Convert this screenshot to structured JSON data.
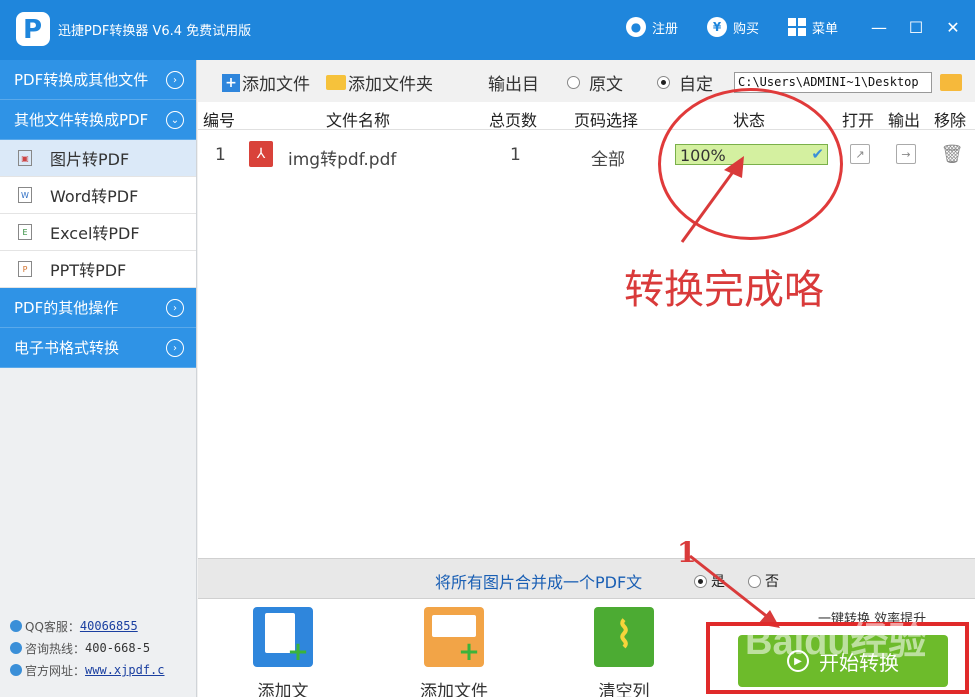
{
  "titlebar": {
    "app_title": "迅捷PDF转换器 V6.4 免费试用版",
    "register_label": "注册",
    "buy_label": "购买",
    "menu_label": "菜单",
    "brand_color": "#1f86dc"
  },
  "sidebar": {
    "categories": [
      {
        "label": "PDF转换成其他文件"
      },
      {
        "label": "其他文件转换成PDF"
      },
      {
        "label": "PDF的其他操作"
      },
      {
        "label": "电子书格式转换"
      }
    ],
    "items": [
      {
        "label": "图片转PDF",
        "icon": "image-file-icon"
      },
      {
        "label": "Word转PDF",
        "icon": "word-file-icon"
      },
      {
        "label": "Excel转PDF",
        "icon": "excel-file-icon"
      },
      {
        "label": "PPT转PDF",
        "icon": "ppt-file-icon"
      }
    ],
    "contact": {
      "qq_label": "QQ客服：",
      "qq_value": "40066855",
      "hotline_label": "咨询热线：",
      "hotline_value": "400-668-5",
      "site_label": "官方网址：",
      "site_value": "www.xjpdf.c"
    }
  },
  "toolbar": {
    "add_file": "添加文件",
    "add_folder": "添加文件夹",
    "output_dir": "输出目",
    "opt_original": "原文",
    "opt_custom": "自定",
    "path_value": "C:\\Users\\ADMINI~1\\Desktop"
  },
  "table": {
    "headers": {
      "index": "编号",
      "filename": "文件名称",
      "pages": "总页数",
      "page_select": "页码选择",
      "status": "状态",
      "open": "打开",
      "output": "输出",
      "remove": "移除"
    },
    "rows": [
      {
        "index": "1",
        "filename": "img转pdf.pdf",
        "pages": "1",
        "page_select": "全部",
        "status": "100%",
        "progress": 1.0
      }
    ]
  },
  "annotations": {
    "done_text": "转换完成咯",
    "step_number": "1",
    "color": "#e03a3a"
  },
  "merge": {
    "label": "将所有图片合并成一个PDF文",
    "opt_yes": "是",
    "opt_no": "否"
  },
  "bottom": {
    "add_file": "添加文",
    "add_folder": "添加文件",
    "clear_list": "清空列",
    "slogan": "一键转换 效率提升",
    "start_button": "开始转换",
    "start_color": "#6dbb2b",
    "watermark": "Baidu经验"
  }
}
